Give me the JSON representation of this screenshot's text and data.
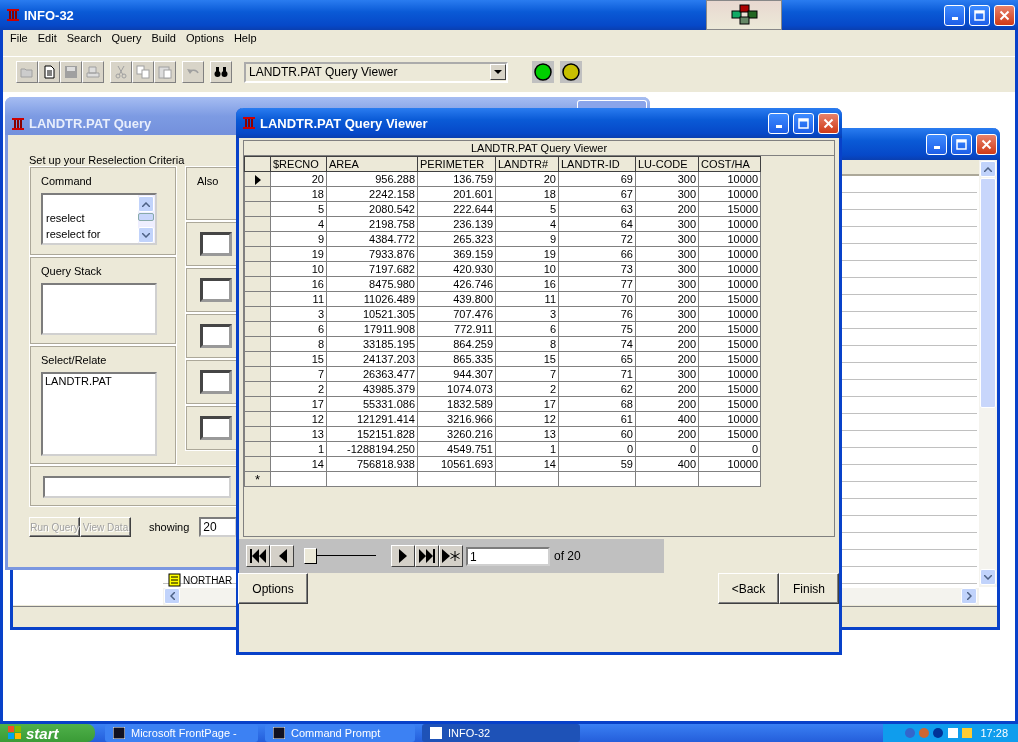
{
  "main_window": {
    "title": "INFO-32",
    "menu": [
      "File",
      "Edit",
      "Search",
      "Query",
      "Build",
      "Options",
      "Help"
    ],
    "toolbar": [
      {
        "kind": "open",
        "disabled": true
      },
      {
        "kind": "new",
        "disabled": false
      },
      {
        "kind": "save",
        "disabled": true
      },
      {
        "kind": "print",
        "disabled": true
      },
      {
        "kind": "cut",
        "disabled": true
      },
      {
        "kind": "copy",
        "disabled": true
      },
      {
        "kind": "paste",
        "disabled": true
      },
      {
        "kind": "undo",
        "disabled": true
      },
      {
        "kind": "find",
        "disabled": false
      }
    ],
    "window_selector": {
      "value": "LANDTR.PAT Query Viewer"
    },
    "lights": [
      {
        "color": "#00d000"
      },
      {
        "color": "#c8c000"
      }
    ]
  },
  "background_window": {
    "items": [
      "NORTHAR"
    ]
  },
  "query_window": {
    "title": "LANDTR.PAT Query",
    "heading": "Set up your Reselection Criteria",
    "command": {
      "label": "Command",
      "options": [
        "reselect",
        "reselect for"
      ]
    },
    "also_label": "Also",
    "query_stack": {
      "label": "Query Stack"
    },
    "select_relate": {
      "label": "Select/Relate",
      "items": [
        "LANDTR.PAT"
      ]
    },
    "buttons": [
      {
        "label": "Run Query",
        "disabled": true
      },
      {
        "label": "View Data",
        "disabled": true
      }
    ],
    "showing": {
      "label": "showing",
      "value": "20"
    }
  },
  "viewer": {
    "title": "LANDTR.PAT Query Viewer",
    "table": {
      "caption": "LANDTR.PAT Query Viewer",
      "columns": [
        "$RECNO",
        "AREA",
        "PERIMETER",
        "LANDTR#",
        "LANDTR-ID",
        "LU-CODE",
        "COST/HA"
      ],
      "rows": [
        {
          "selected": true,
          "cells": [
            "20",
            "956.288",
            "136.759",
            "20",
            "69",
            "300",
            "10000"
          ]
        },
        {
          "selected": false,
          "cells": [
            "18",
            "2242.158",
            "201.601",
            "18",
            "67",
            "300",
            "10000"
          ]
        },
        {
          "selected": false,
          "cells": [
            "5",
            "2080.542",
            "222.644",
            "5",
            "63",
            "200",
            "15000"
          ]
        },
        {
          "selected": false,
          "cells": [
            "4",
            "2198.758",
            "236.139",
            "4",
            "64",
            "300",
            "10000"
          ]
        },
        {
          "selected": false,
          "cells": [
            "9",
            "4384.772",
            "265.323",
            "9",
            "72",
            "300",
            "10000"
          ]
        },
        {
          "selected": false,
          "cells": [
            "19",
            "7933.876",
            "369.159",
            "19",
            "66",
            "300",
            "10000"
          ]
        },
        {
          "selected": false,
          "cells": [
            "10",
            "7197.682",
            "420.930",
            "10",
            "73",
            "300",
            "10000"
          ]
        },
        {
          "selected": false,
          "cells": [
            "16",
            "8475.980",
            "426.746",
            "16",
            "77",
            "300",
            "10000"
          ]
        },
        {
          "selected": false,
          "cells": [
            "11",
            "11026.489",
            "439.800",
            "11",
            "70",
            "200",
            "15000"
          ]
        },
        {
          "selected": false,
          "cells": [
            "3",
            "10521.305",
            "707.476",
            "3",
            "76",
            "300",
            "10000"
          ]
        },
        {
          "selected": false,
          "cells": [
            "6",
            "17911.908",
            "772.911",
            "6",
            "75",
            "200",
            "15000"
          ]
        },
        {
          "selected": false,
          "cells": [
            "8",
            "33185.195",
            "864.259",
            "8",
            "74",
            "200",
            "15000"
          ]
        },
        {
          "selected": false,
          "cells": [
            "15",
            "24137.203",
            "865.335",
            "15",
            "65",
            "200",
            "15000"
          ]
        },
        {
          "selected": false,
          "cells": [
            "7",
            "26363.477",
            "944.307",
            "7",
            "71",
            "300",
            "10000"
          ]
        },
        {
          "selected": false,
          "cells": [
            "2",
            "43985.379",
            "1074.073",
            "2",
            "62",
            "200",
            "15000"
          ]
        },
        {
          "selected": false,
          "cells": [
            "17",
            "55331.086",
            "1832.589",
            "17",
            "68",
            "200",
            "15000"
          ]
        },
        {
          "selected": false,
          "cells": [
            "12",
            "121291.414",
            "3216.966",
            "12",
            "61",
            "400",
            "10000"
          ]
        },
        {
          "selected": false,
          "cells": [
            "13",
            "152151.828",
            "3260.216",
            "13",
            "60",
            "200",
            "15000"
          ]
        },
        {
          "selected": false,
          "cells": [
            "1",
            "-1288194.250",
            "4549.751",
            "1",
            "0",
            "0",
            "0"
          ]
        },
        {
          "selected": false,
          "cells": [
            "14",
            "756818.938",
            "10561.693",
            "14",
            "59",
            "400",
            "10000"
          ]
        }
      ],
      "new_row_marker": "*"
    },
    "navigator": {
      "level": 0,
      "record": "1",
      "count": "of 20"
    },
    "buttons": {
      "options": "Options",
      "back": "<Back",
      "finish": "Finish"
    }
  },
  "taskbar": {
    "start": "start",
    "tasks": [
      {
        "label": "Microsoft FrontPage -",
        "selected": false
      },
      {
        "label": "Command Prompt",
        "selected": false
      },
      {
        "label": "INFO-32",
        "selected": true
      }
    ],
    "clock": "17:28"
  }
}
